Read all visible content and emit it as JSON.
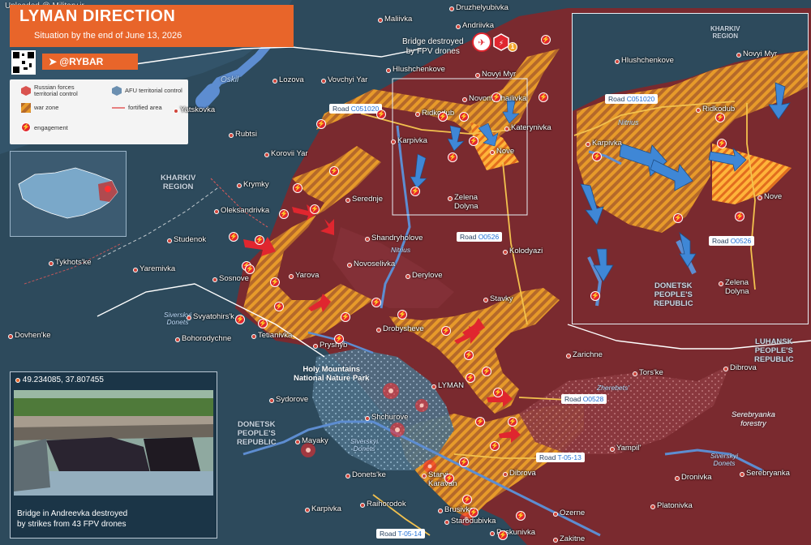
{
  "watermark": "Uploaded @ Military.ir",
  "header": {
    "title": "LYMAN DIRECTION",
    "subtitle": "Situation by the end of June 13, 2026"
  },
  "brand": "@RYBAR",
  "legend": {
    "russian": "Russian forces\nterritorial control",
    "afu": "AFU territorial control",
    "war_zone": "war zone",
    "fortified": "fortified area",
    "engagement": "engagement"
  },
  "regions": {
    "kharkiv": "KHARKIV\nREGION",
    "donetsk": "DONETSK\nPEOPLE'S\nREPUBLIC",
    "luhansk": "LUHANSK\nPEOPLE'S\nREPUBLIC",
    "park": "Holy Mountains\nNational Nature Park",
    "forestry": "Serebryanka\nforestry",
    "zoom_kharkiv": "KHARKIV\nREGION",
    "zoom_donetsk": "DONETSK\nPEOPLE'S\nREPUBLIC"
  },
  "rivers": {
    "oskil": "Oskil",
    "nitrius": "Nitrius",
    "siversky_donets_1": "Siverskyi\nDonets",
    "siversky_donets_2": "Siverskyi\nDonets",
    "siversky_donets_3": "Siverskyi\nDonets",
    "zherebets": "Zherebets'",
    "zoom_nitrius": "Nitrius"
  },
  "roads": {
    "c051020": {
      "prefix": "Road ",
      "code": "C051020"
    },
    "o0526": {
      "prefix": "Road ",
      "code": "O0526"
    },
    "o0528": {
      "prefix": "Road ",
      "code": "O0528"
    },
    "t0513": {
      "prefix": "Road ",
      "code": "T-05-13"
    },
    "t0514": {
      "prefix": "Road ",
      "code": "T-05-14"
    },
    "zoom_c051020": {
      "prefix": "Road ",
      "code": "C051020"
    },
    "zoom_o0526": {
      "prefix": "Road ",
      "code": "O0526"
    }
  },
  "places": [
    {
      "name": "Maliivka"
    },
    {
      "name": "Andriivka"
    },
    {
      "name": "Druzhelyubivka"
    },
    {
      "name": "Hlushchenkove"
    },
    {
      "name": "Novyi Myr"
    },
    {
      "name": "Lozova"
    },
    {
      "name": "Vovchyi Yar"
    },
    {
      "name": "Yatskovka"
    },
    {
      "name": "Rubtsi"
    },
    {
      "name": "Korovii Yar"
    },
    {
      "name": "Ridkodub"
    },
    {
      "name": "Novomykhailivka"
    },
    {
      "name": "Katerynivka"
    },
    {
      "name": "Karpivka"
    },
    {
      "name": "Nove"
    },
    {
      "name": "Krymky"
    },
    {
      "name": "Serednje"
    },
    {
      "name": "Zelena\nDolyna"
    },
    {
      "name": "Oleksandrivka"
    },
    {
      "name": "Studenok"
    },
    {
      "name": "Shandryholove"
    },
    {
      "name": "Kolodyazi"
    },
    {
      "name": "Tykhots'ke"
    },
    {
      "name": "Yaremivka"
    },
    {
      "name": "Novoselivka"
    },
    {
      "name": "Sosnove"
    },
    {
      "name": "Yarova"
    },
    {
      "name": "Derylove"
    },
    {
      "name": "Stavky"
    },
    {
      "name": "Svyatohirs'k"
    },
    {
      "name": "Dovhen'ke"
    },
    {
      "name": "Bohorodychne"
    },
    {
      "name": "Tetianivka"
    },
    {
      "name": "Drobysheve"
    },
    {
      "name": "Pryshyb"
    },
    {
      "name": "Zarichne"
    },
    {
      "name": "Tors'ke"
    },
    {
      "name": "Dibrova"
    },
    {
      "name": "LYMAN"
    },
    {
      "name": "Sydorove"
    },
    {
      "name": "Shchurove"
    },
    {
      "name": "Yampil'"
    },
    {
      "name": "Mayaky"
    },
    {
      "name": "Donets'ke"
    },
    {
      "name": "Staryi\nKaravan"
    },
    {
      "name": "Dibrova"
    },
    {
      "name": "Dronivka"
    },
    {
      "name": "Serebryanka"
    },
    {
      "name": "Raihorodok"
    },
    {
      "name": "Brusivka"
    },
    {
      "name": "Ozerne"
    },
    {
      "name": "Platonivka"
    },
    {
      "name": "Karpivka"
    },
    {
      "name": "Starodubivka"
    },
    {
      "name": "Pyskunivka"
    },
    {
      "name": "Zakitne"
    }
  ],
  "zoom_places": [
    {
      "name": "Hlushchenkove"
    },
    {
      "name": "Novyi Myr"
    },
    {
      "name": "Ridkodub"
    },
    {
      "name": "Karpivka"
    },
    {
      "name": "Nove"
    },
    {
      "name": "Zelena\nDolyna"
    }
  ],
  "callouts": {
    "bridge": "Bridge destroyed\nby FPV drones"
  },
  "photo": {
    "coords": "49.234085, 37.807455",
    "caption": "Bridge in Andreevka destroyed\nby strikes from 43 FPV drones"
  },
  "colors": {
    "russian": "#7a2a2f",
    "afu": "#2d4a5c",
    "war_zone": "#e79a2a",
    "accent": "#e8652a",
    "engagement": "#e0262f",
    "river": "#5d8dd1"
  }
}
